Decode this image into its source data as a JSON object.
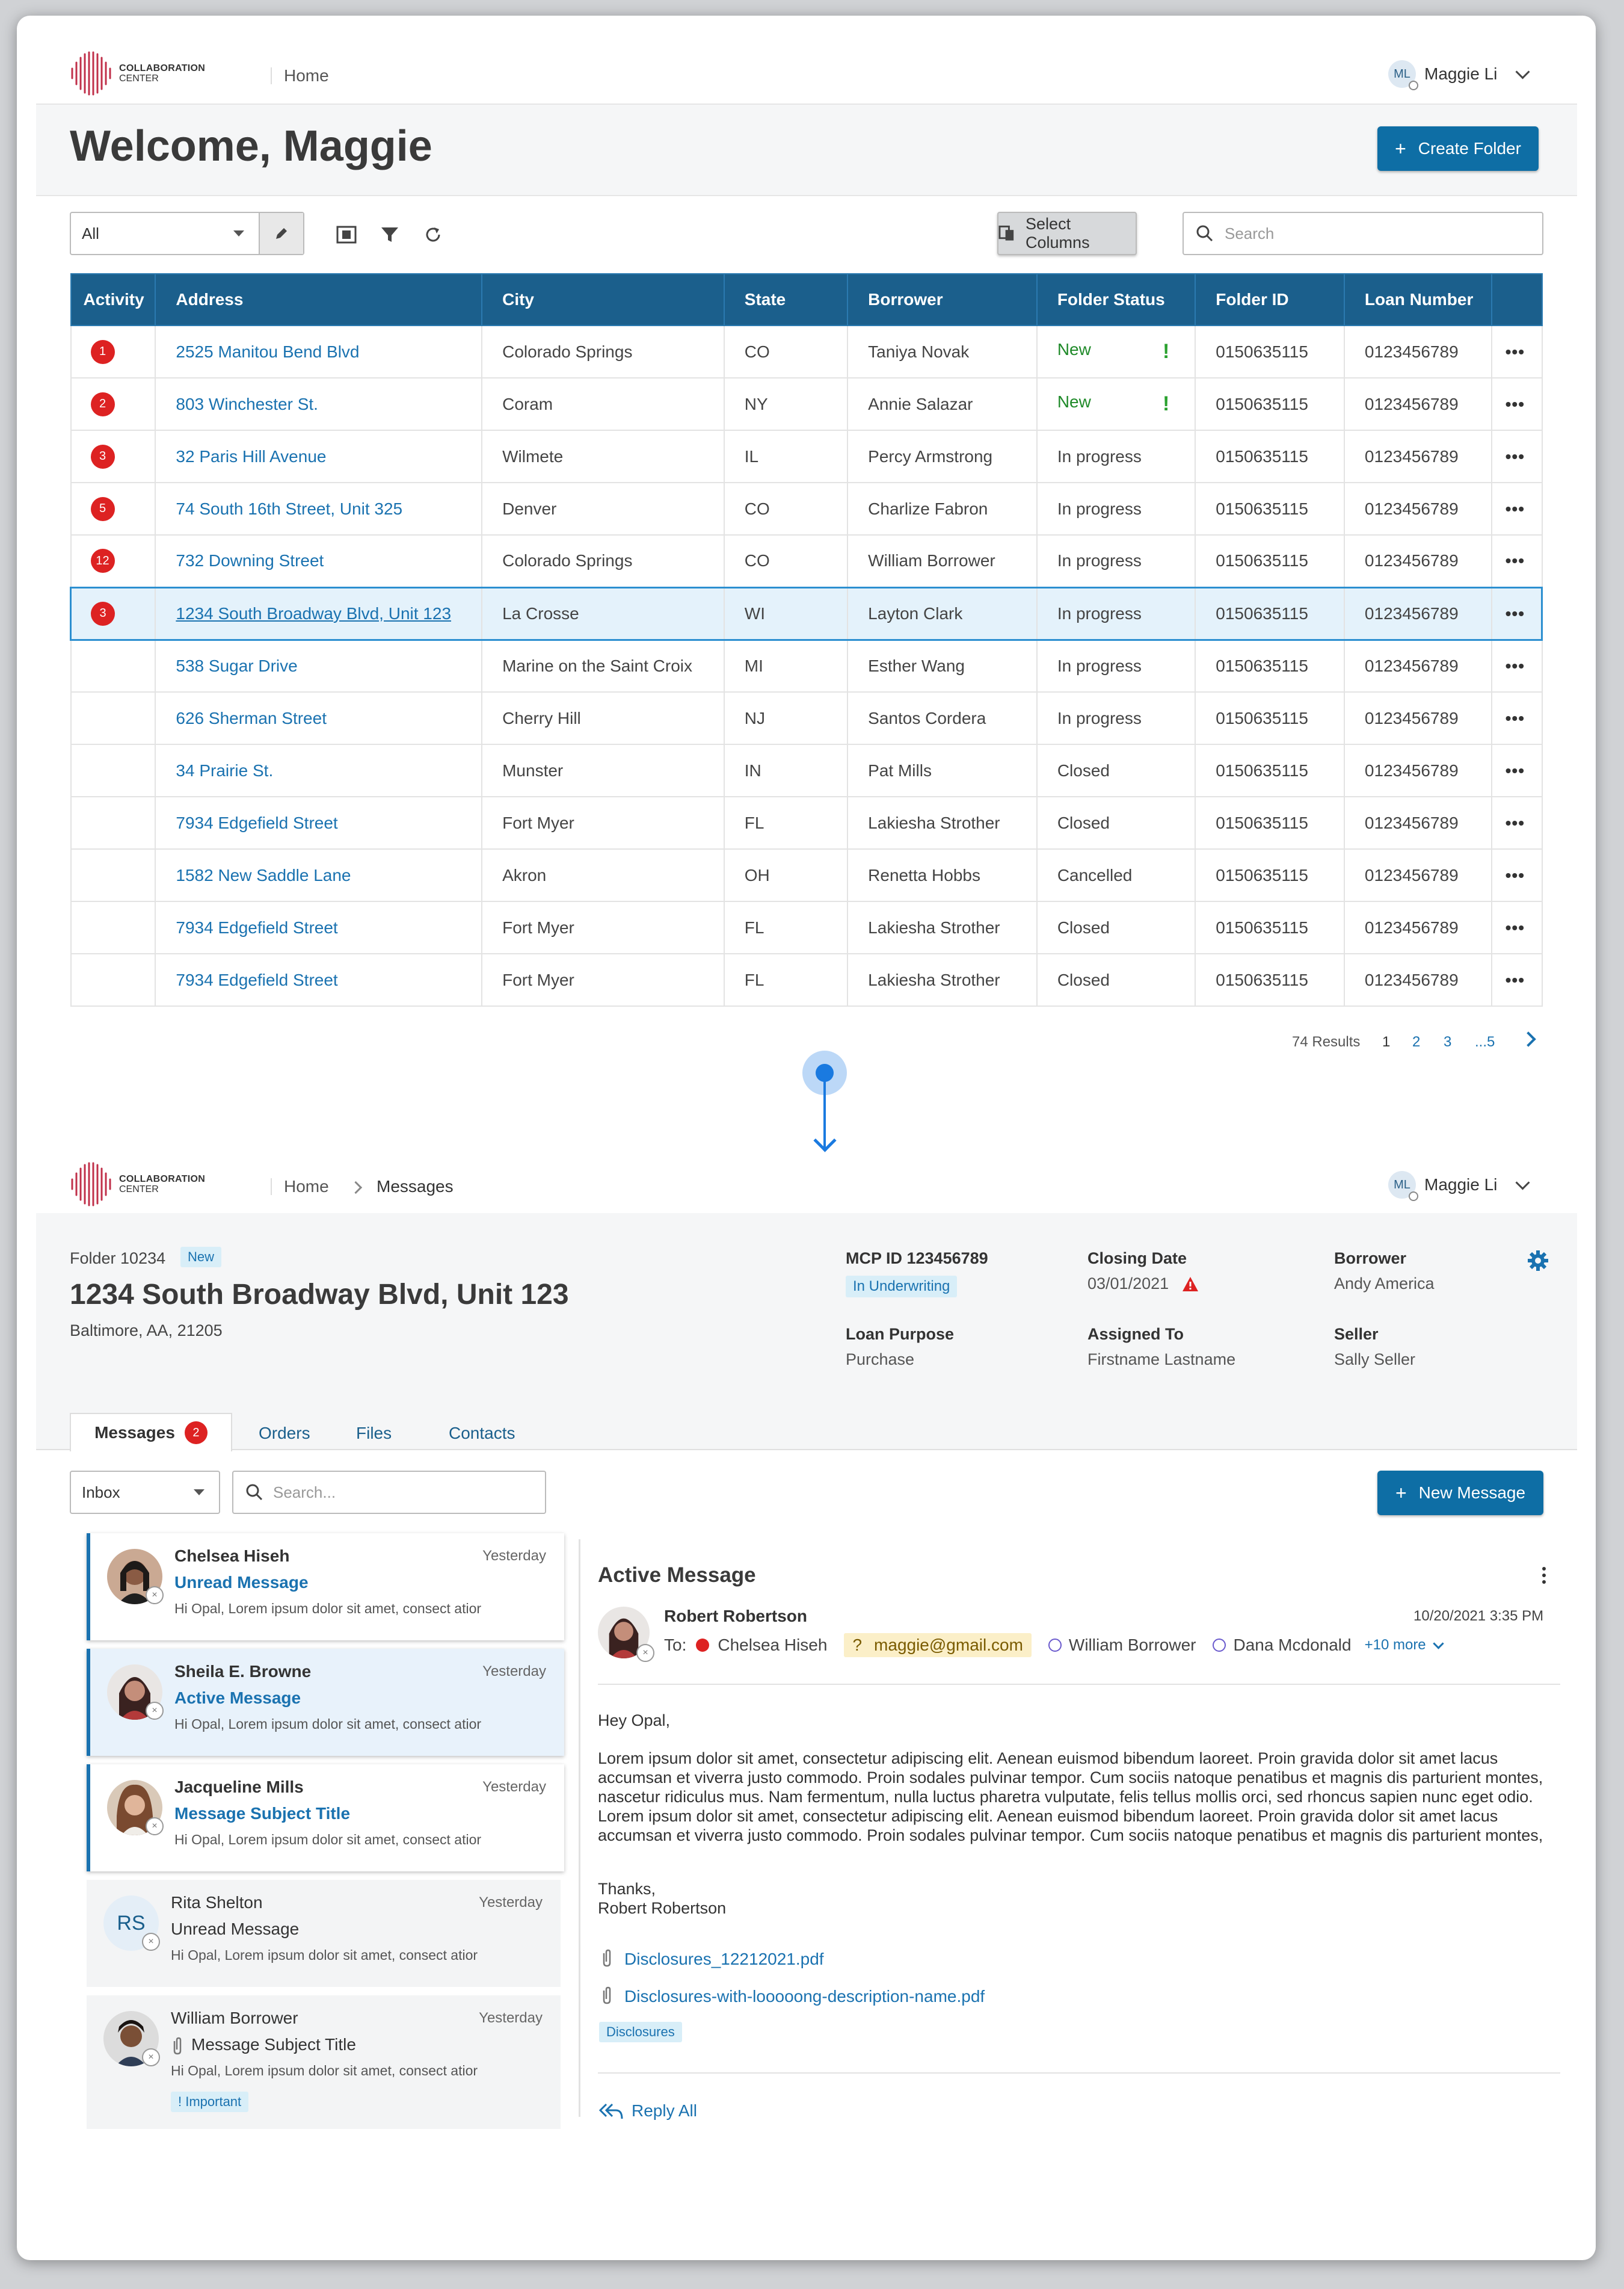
{
  "top": {
    "logo": {
      "line1": "COLLABORATION",
      "line2": "CENTER"
    },
    "breadcrumb": "Home",
    "user": {
      "initials": "ML",
      "name": "Maggie Li"
    },
    "welcome": "Welcome, Maggie",
    "create_folder": "Create Folder",
    "filter_select": "All",
    "select_columns": "Select Columns",
    "search_placeholder": "Search"
  },
  "table": {
    "headers": [
      "Activity",
      "Address",
      "City",
      "State",
      "Borrower",
      "Folder Status",
      "Folder ID",
      "Loan Number"
    ],
    "rows": [
      {
        "activity": "1",
        "address": "2525 Manitou Bend Blvd",
        "city": "Colorado Springs",
        "state": "CO",
        "borrower": "Taniya Novak",
        "status": "New",
        "flag": "!",
        "folder_id": "0150635115",
        "loan": "0123456789"
      },
      {
        "activity": "2",
        "address": "803 Winchester St.",
        "city": "Coram",
        "state": "NY",
        "borrower": "Annie Salazar",
        "status": "New",
        "flag": "!",
        "folder_id": "0150635115",
        "loan": "0123456789"
      },
      {
        "activity": "3",
        "address": "32 Paris Hill Avenue",
        "city": "Wilmete",
        "state": "IL",
        "borrower": "Percy Armstrong",
        "status": "In progress",
        "flag": "",
        "folder_id": "0150635115",
        "loan": "0123456789"
      },
      {
        "activity": "5",
        "address": "74 South 16th Street, Unit 325",
        "city": "Denver",
        "state": "CO",
        "borrower": "Charlize Fabron",
        "status": "In progress",
        "flag": "",
        "folder_id": "0150635115",
        "loan": "0123456789"
      },
      {
        "activity": "12",
        "address": "732 Downing Street",
        "city": "Colorado Springs",
        "state": "CO",
        "borrower": "William Borrower",
        "status": "In progress",
        "flag": "",
        "folder_id": "0150635115",
        "loan": "0123456789"
      },
      {
        "activity": "3",
        "address": "1234 South Broadway Blvd, Unit 123",
        "city": "La Crosse",
        "state": "WI",
        "borrower": "Layton Clark",
        "status": "In progress",
        "flag": "",
        "folder_id": "0150635115",
        "loan": "0123456789",
        "selected": true
      },
      {
        "activity": "",
        "address": "538 Sugar Drive",
        "city": "Marine on the Saint Croix",
        "state": "MI",
        "borrower": "Esther Wang",
        "status": "In progress",
        "flag": "",
        "folder_id": "0150635115",
        "loan": "0123456789"
      },
      {
        "activity": "",
        "address": "626 Sherman Street",
        "city": "Cherry Hill",
        "state": "NJ",
        "borrower": "Santos Cordera",
        "status": "In progress",
        "flag": "",
        "folder_id": "0150635115",
        "loan": "0123456789"
      },
      {
        "activity": "",
        "address": "34 Prairie St.",
        "city": "Munster",
        "state": "IN",
        "borrower": "Pat Mills",
        "status": "Closed",
        "flag": "",
        "folder_id": "0150635115",
        "loan": "0123456789"
      },
      {
        "activity": "",
        "address": "7934 Edgefield Street",
        "city": "Fort Myer",
        "state": "FL",
        "borrower": "Lakiesha Strother",
        "status": "Closed",
        "flag": "",
        "folder_id": "0150635115",
        "loan": "0123456789"
      },
      {
        "activity": "",
        "address": "1582 New Saddle Lane",
        "city": "Akron",
        "state": "OH",
        "borrower": "Renetta Hobbs",
        "status": "Cancelled",
        "flag": "",
        "folder_id": "0150635115",
        "loan": "0123456789"
      },
      {
        "activity": "",
        "address": "7934 Edgefield Street",
        "city": "Fort Myer",
        "state": "FL",
        "borrower": "Lakiesha Strother",
        "status": "Closed",
        "flag": "",
        "folder_id": "0150635115",
        "loan": "0123456789"
      },
      {
        "activity": "",
        "address": "7934 Edgefield Street",
        "city": "Fort Myer",
        "state": "FL",
        "borrower": "Lakiesha Strother",
        "status": "Closed",
        "flag": "",
        "folder_id": "0150635115",
        "loan": "0123456789"
      }
    ],
    "row_menu": "•••"
  },
  "pagination": {
    "results": "74 Results",
    "pages": [
      "1",
      "2",
      "3",
      "...5"
    ]
  },
  "detail": {
    "breadcrumb_home": "Home",
    "breadcrumb_current": "Messages",
    "folder_label": "Folder 10234",
    "folder_status": "New",
    "address": "1234 South Broadway Blvd, Unit 123",
    "city_line": "Baltimore, AA, 21205",
    "mcp_id": "MCP ID 123456789",
    "mcp_status": "In Underwriting",
    "closing_label": "Closing Date",
    "closing_value": "03/01/2021",
    "borrower_label": "Borrower",
    "borrower_value": "Andy America",
    "purpose_label": "Loan Purpose",
    "purpose_value": "Purchase",
    "assigned_label": "Assigned To",
    "assigned_value": "Firstname Lastname",
    "seller_label": "Seller",
    "seller_value": "Sally Seller",
    "tabs": [
      "Messages",
      "Orders",
      "Files",
      "Contacts"
    ],
    "messages_badge": "2",
    "inbox_select": "Inbox",
    "search_placeholder": "Search...",
    "new_message": "New Message"
  },
  "messages": [
    {
      "name": "Chelsea Hiseh",
      "date": "Yesterday",
      "subject": "Unread Message",
      "snippet": "Hi Opal, Lorem ipsum dolor sit amet, consect atior"
    },
    {
      "name": "Sheila E. Browne",
      "date": "Yesterday",
      "subject": "Active Message",
      "snippet": "Hi Opal, Lorem ipsum dolor sit amet, consect atior"
    },
    {
      "name": "Jacqueline Mills",
      "date": "Yesterday",
      "subject": "Message Subject Title",
      "snippet": "Hi Opal, Lorem ipsum dolor sit amet, consect atior"
    },
    {
      "name": "Rita Shelton",
      "initials": "RS",
      "date": "Yesterday",
      "subject": "Unread Message",
      "snippet": "Hi Opal, Lorem ipsum dolor sit amet, consect atior"
    },
    {
      "name": "William Borrower",
      "date": "Yesterday",
      "subject": "Message Subject Title",
      "snippet": "Hi Opal, Lorem ipsum dolor sit amet, consect atior",
      "tag": "! Important"
    }
  ],
  "active": {
    "title": "Active Message",
    "sender": "Robert Robertson",
    "timestamp": "10/20/2021 3:35 PM",
    "to_label": "To:",
    "recipients": [
      "Chelsea Hiseh",
      "maggie@gmail.com",
      "William Borrower",
      "Dana Mcdonald"
    ],
    "unknown_mark": "?",
    "more": "+10 more",
    "greeting": "Hey Opal,",
    "body": "Lorem ipsum dolor sit amet, consectetur adipiscing elit. Aenean euismod bibendum laoreet. Proin gravida dolor sit amet lacus accumsan et viverra justo commodo. Proin sodales pulvinar tempor. Cum sociis natoque penatibus et magnis dis parturient montes, nascetur ridiculus mus. Nam fermentum, nulla luctus pharetra vulputate, felis tellus mollis orci, sed rhoncus sapien nunc eget odio. Lorem ipsum dolor sit amet, consectetur adipiscing elit. Aenean euismod bibendum laoreet. Proin gravida dolor sit amet lacus accumsan et viverra justo commodo. Proin sodales pulvinar tempor. Cum sociis natoque penatibus et magnis dis parturient montes,",
    "signoff1": "Thanks,",
    "signoff2": "Robert Robertson",
    "attachments": [
      "Disclosures_12212021.pdf",
      "Disclosures-with-looooong-description-name.pdf"
    ],
    "tag": "Disclosures",
    "reply_all": "Reply All"
  },
  "colors": {
    "primary": "#0e6ea5",
    "header": "#1b5f8c",
    "link": "#1a72b0",
    "alert": "#d22222",
    "new_status": "#1f8a29"
  }
}
